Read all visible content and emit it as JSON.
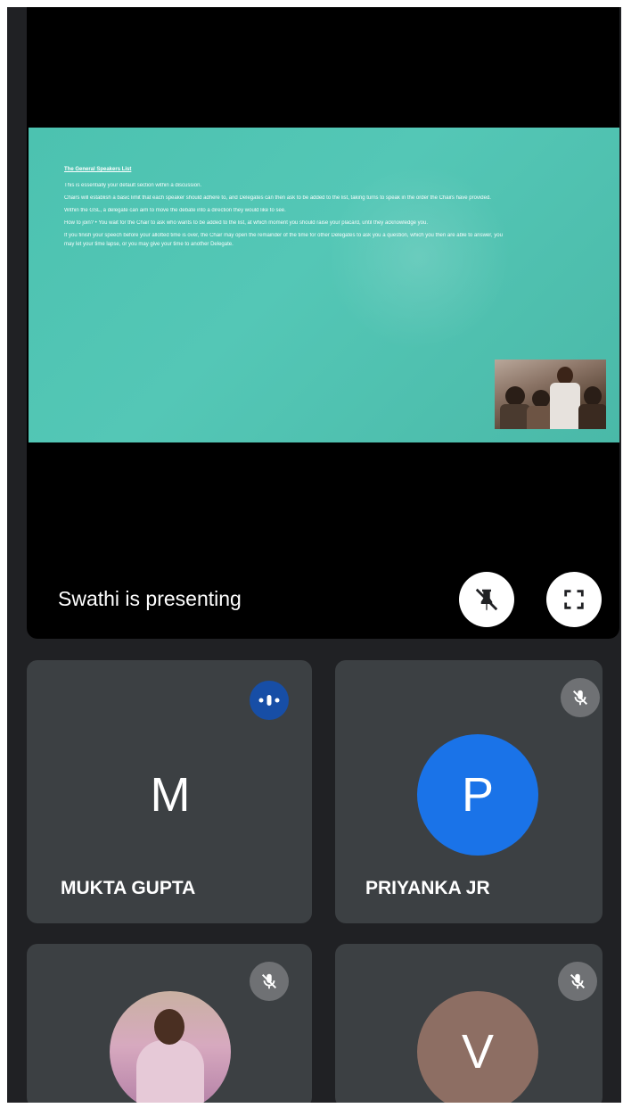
{
  "presentation": {
    "slide": {
      "heading": "The General Speakers List",
      "lines": [
        "This is essentially your default section within a discussion.",
        "Chairs will establish a basic limit that each speaker should adhere to, and Delegates can then ask to be added to the list, taking turns to speak in the order the Chairs have provided.",
        "Within the GSL, a delegate can aim to move the debate into a direction they would like to see.",
        "How to join? • You wait for the Chair to ask who wants to be added to the list, at which moment you should raise your placard, until they acknowledge you.",
        "If you finish your speech before your allotted time is over, the Chair may open the remainder of the time for other Delegates to ask you a question, which you then are able to answer, you may let your time lapse, or you may give your time to another Delegate."
      ]
    },
    "presenting_label": "Swathi is presenting",
    "pin_icon": "pin-off-icon",
    "fullscreen_icon": "fullscreen-icon"
  },
  "participants": [
    {
      "initial": "M",
      "name": "MUKTA GUPTA",
      "avatar_color": "#5f6f7b",
      "status": "speaking"
    },
    {
      "initial": "P",
      "name": "PRIYANKA JR",
      "avatar_color": "#1a73e8",
      "status": "muted"
    },
    {
      "initial": "",
      "name": "",
      "avatar_color": "",
      "status": "muted"
    },
    {
      "initial": "V",
      "name": "",
      "avatar_color": "#8d6e63",
      "status": "muted"
    }
  ],
  "colors": {
    "background": "#202124",
    "tile": "#3c4043",
    "slide": "#4fc3b2",
    "speaking_badge": "#174ea6"
  }
}
